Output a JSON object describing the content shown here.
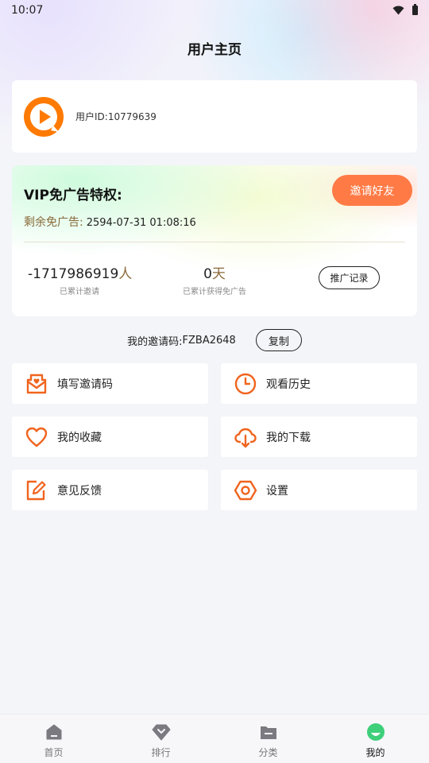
{
  "status_bar": {
    "time": "10:07",
    "icons": [
      "wifi-icon",
      "battery-icon"
    ]
  },
  "header": {
    "title": "用户主页"
  },
  "user": {
    "avatar_icon": "play-logo-icon",
    "id_text": "用户ID:10779639"
  },
  "vip": {
    "title": "VIP免广告特权:",
    "invite_button": "邀请好友",
    "remain_label": "剩余免广告:",
    "remain_value": "2594-07-31 01:08:16",
    "invites_count": "-1717986919",
    "invites_unit": "人",
    "invites_caption": "已累计邀请",
    "days_count": "0",
    "days_unit": "天",
    "days_caption": "已累计获得免广告",
    "record_button": "推广记录"
  },
  "invite_code": {
    "label": "我的邀请码:",
    "code": "FZBA2648",
    "copy_button": "复制"
  },
  "menu": [
    {
      "label": "填写邀请码",
      "icon": "mail-heart-icon"
    },
    {
      "label": "观看历史",
      "icon": "clock-icon"
    },
    {
      "label": "我的收藏",
      "icon": "heart-icon"
    },
    {
      "label": "我的下载",
      "icon": "cloud-download-icon"
    },
    {
      "label": "意见反馈",
      "icon": "edit-icon"
    },
    {
      "label": "设置",
      "icon": "settings-hex-icon"
    }
  ],
  "tabs": [
    {
      "label": "首页",
      "icon": "home-icon",
      "active": false
    },
    {
      "label": "排行",
      "icon": "rank-icon",
      "active": false
    },
    {
      "label": "分类",
      "icon": "folder-icon",
      "active": false
    },
    {
      "label": "我的",
      "icon": "profile-icon",
      "active": true
    }
  ],
  "colors": {
    "accent": "#ff7a45",
    "icon_orange": "#f0641e",
    "gold_text": "#8a6a3a",
    "active_tab": "#3ecf7a"
  }
}
